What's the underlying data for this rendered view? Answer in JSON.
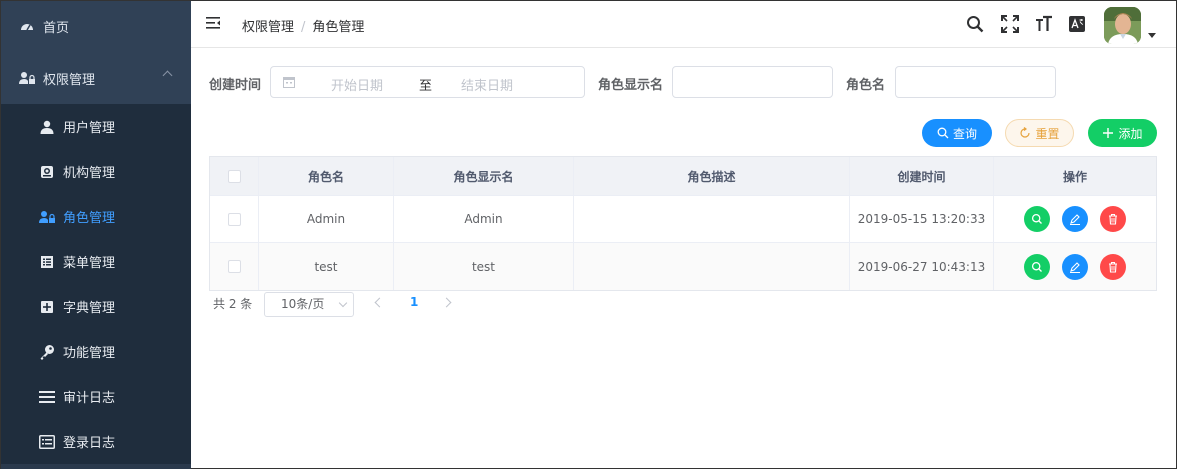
{
  "sidebar": {
    "home": {
      "label": "首页",
      "icon": "dashboard-icon"
    },
    "group": {
      "label": "权限管理",
      "icon": "user-lock-icon"
    },
    "items": [
      {
        "label": "用户管理",
        "icon": "user-icon"
      },
      {
        "label": "机构管理",
        "icon": "organization-icon"
      },
      {
        "label": "角色管理",
        "icon": "role-icon"
      },
      {
        "label": "菜单管理",
        "icon": "menu-list-icon"
      },
      {
        "label": "字典管理",
        "icon": "dictionary-icon"
      },
      {
        "label": "功能管理",
        "icon": "key-icon"
      },
      {
        "label": "审计日志",
        "icon": "list-icon"
      },
      {
        "label": "登录日志",
        "icon": "login-log-icon"
      }
    ],
    "active_index": 2,
    "colors": {
      "bg": "#1f2d3d",
      "group_bg": "#304156",
      "active": "#409eff"
    }
  },
  "navbar": {
    "breadcrumb": [
      "权限管理",
      "角色管理"
    ],
    "separator": "/",
    "icons": [
      "search-icon",
      "fullscreen-icon",
      "font-size-icon",
      "translate-icon"
    ]
  },
  "search_form": {
    "created_label": "创建时间",
    "start_placeholder": "开始日期",
    "to_text": "至",
    "end_placeholder": "结束日期",
    "display_name_label": "角色显示名",
    "role_name_label": "角色名"
  },
  "buttons": {
    "search": "查询",
    "reset": "重置",
    "add": "添加"
  },
  "table": {
    "headers": [
      "角色名",
      "角色显示名",
      "角色描述",
      "创建时间",
      "操作"
    ],
    "rows": [
      {
        "name": "Admin",
        "display": "Admin",
        "desc": "",
        "created": "2019-05-15 13:20:33"
      },
      {
        "name": "test",
        "display": "test",
        "desc": "",
        "created": "2019-06-27 10:43:13"
      }
    ]
  },
  "pagination": {
    "total": "共 2 条",
    "page_size": "10条/页",
    "current_page": "1"
  }
}
